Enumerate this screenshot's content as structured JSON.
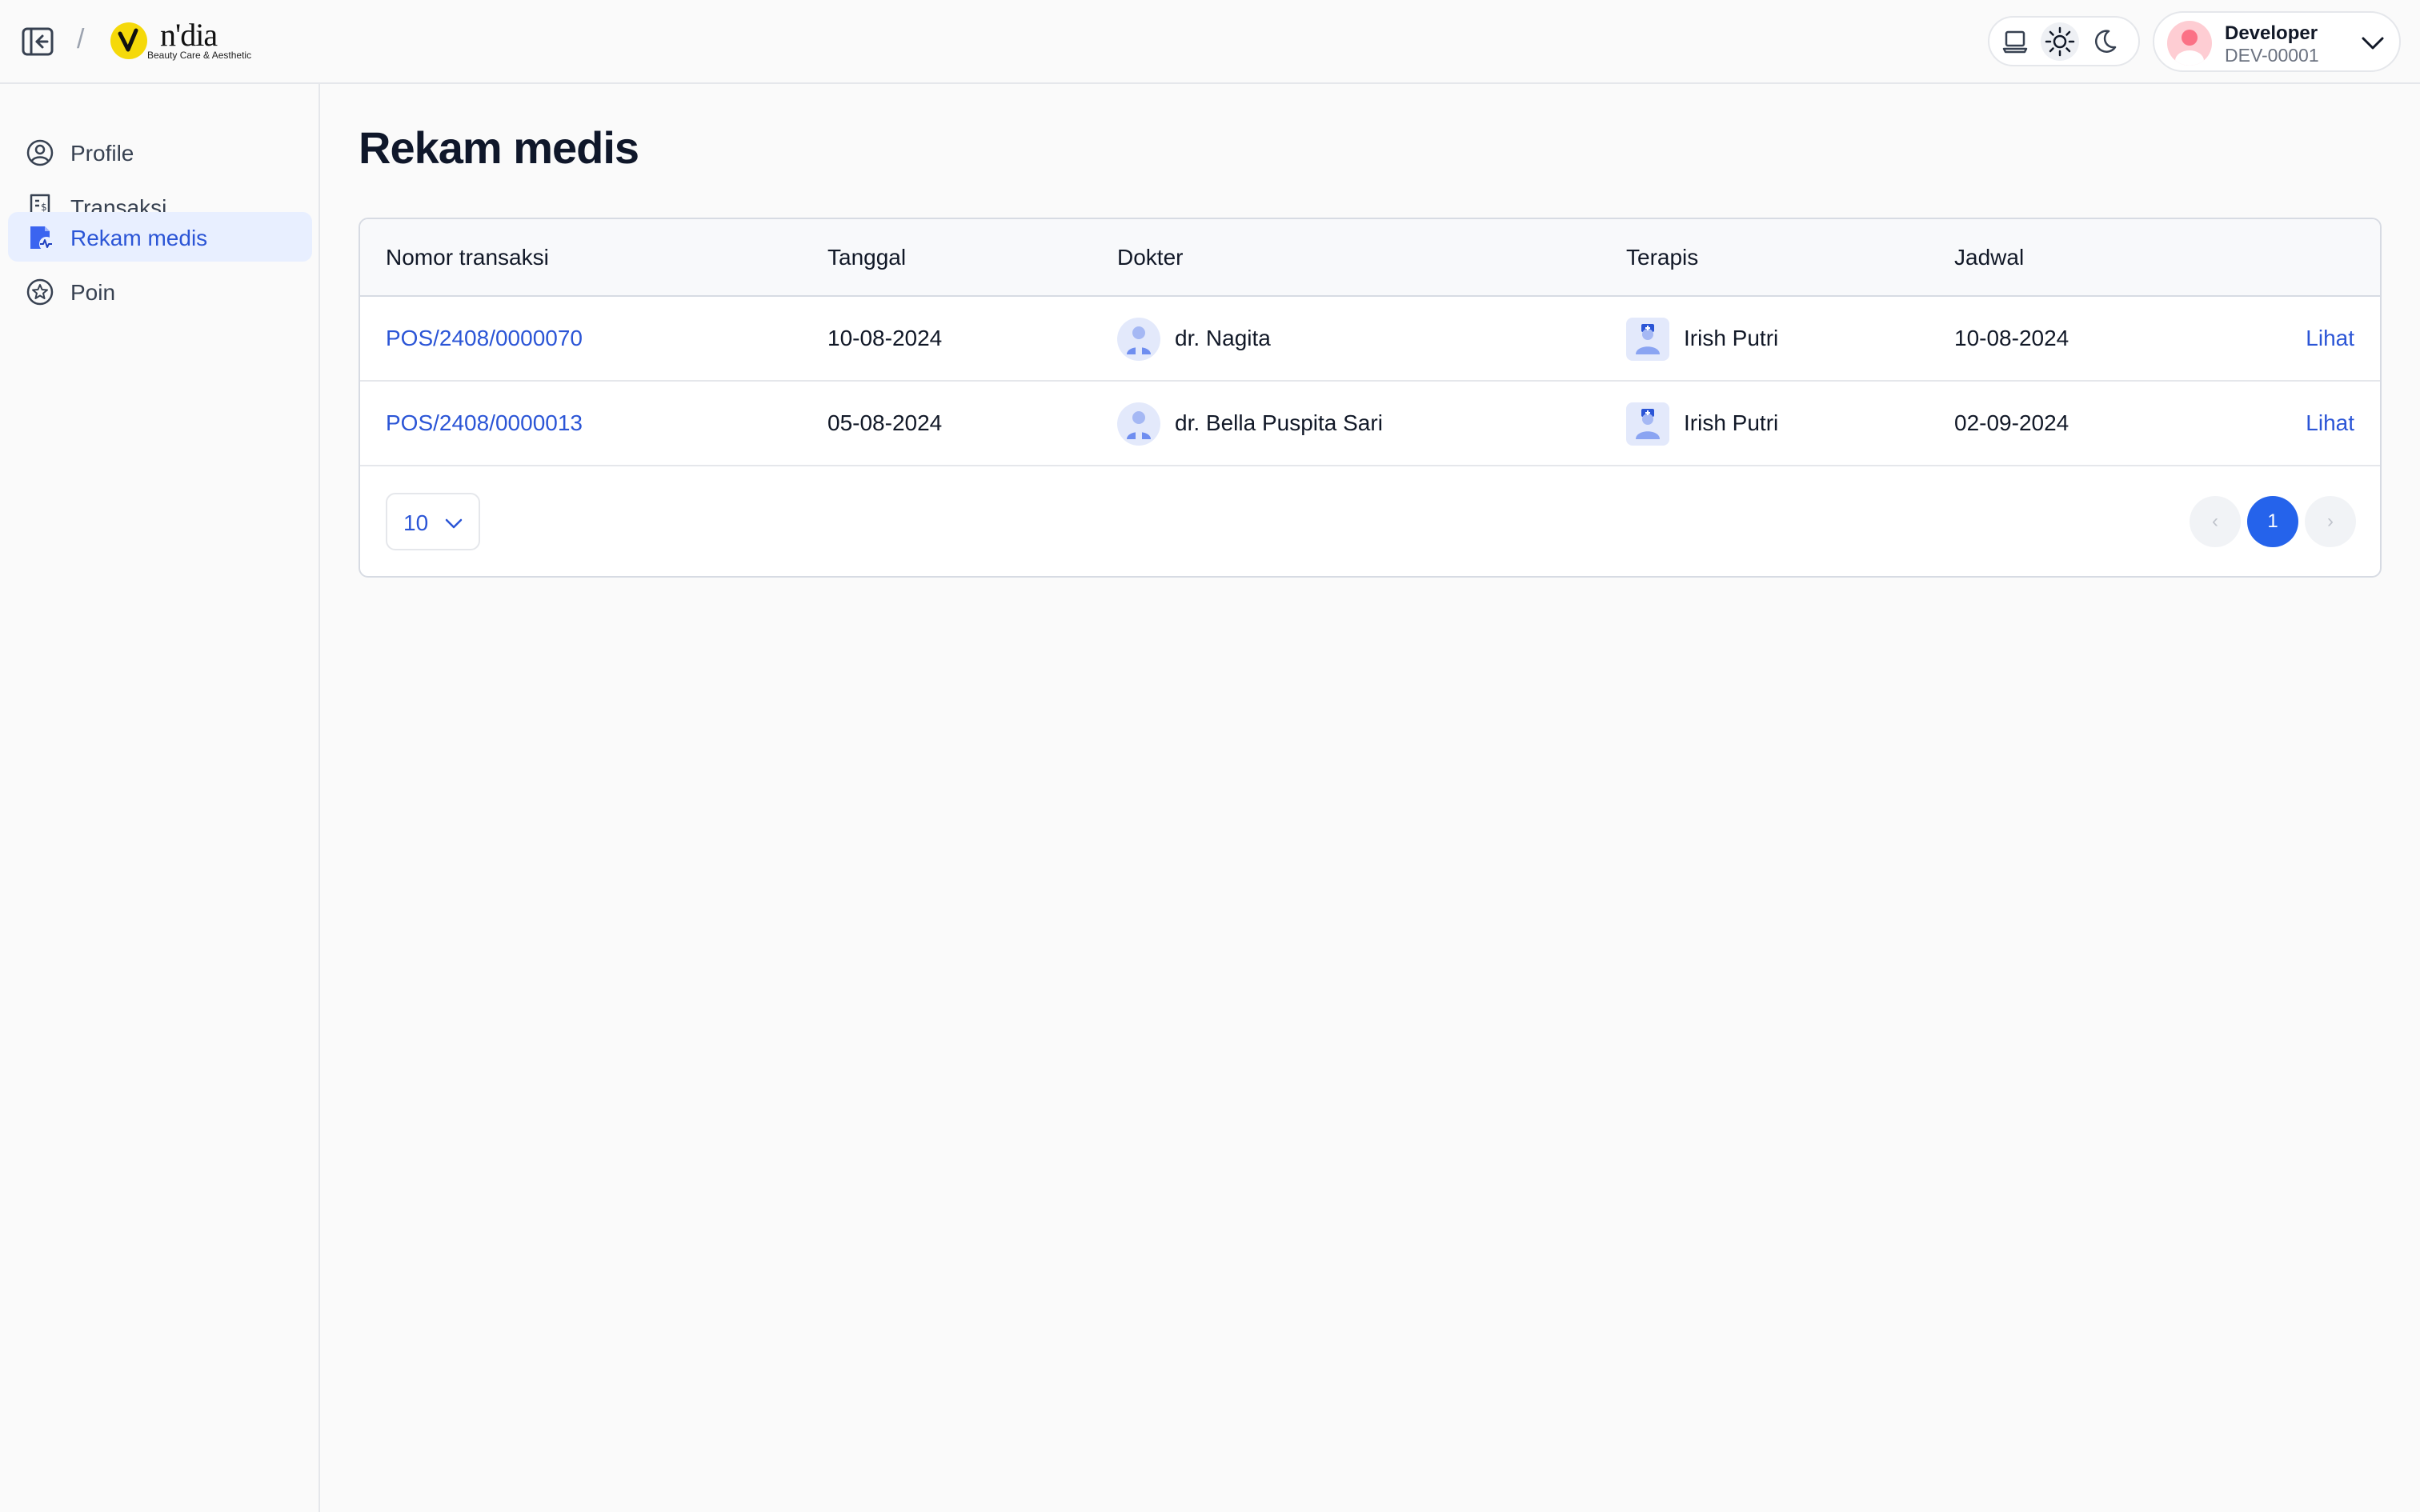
{
  "header": {
    "breadcrumb_separator": "/",
    "logo": {
      "name": "n'dia",
      "tagline": "Beauty Care & Aesthetic"
    },
    "theme": {
      "options": [
        "system",
        "light",
        "dark"
      ],
      "active": "light"
    },
    "user": {
      "name": "Developer",
      "id": "DEV-00001"
    }
  },
  "sidebar": {
    "items": [
      {
        "label": "Profile",
        "icon": "user-circle-icon",
        "active": false
      },
      {
        "label": "Transaksi",
        "icon": "receipt-icon",
        "active": false
      },
      {
        "label": "Rekam medis",
        "icon": "medical-record-icon",
        "active": true
      },
      {
        "label": "Poin",
        "icon": "star-badge-icon",
        "active": false
      }
    ]
  },
  "main": {
    "title": "Rekam medis",
    "table": {
      "columns": [
        "Nomor transaksi",
        "Tanggal",
        "Dokter",
        "Terapis",
        "Jadwal"
      ],
      "rows": [
        {
          "nomor": "POS/2408/0000070",
          "tanggal": "10-08-2024",
          "dokter": "dr. Nagita",
          "terapis": "Irish Putri",
          "jadwal": "10-08-2024",
          "action": "Lihat"
        },
        {
          "nomor": "POS/2408/0000013",
          "tanggal": "05-08-2024",
          "dokter": "dr. Bella Puspita Sari",
          "terapis": "Irish Putri",
          "jadwal": "02-09-2024",
          "action": "Lihat"
        }
      ]
    },
    "pagination": {
      "page_size": "10",
      "prev": "‹",
      "current_page": "1",
      "next": "›"
    }
  },
  "colors": {
    "accent": "#2b55d6",
    "active_bg": "#e8efff",
    "current_page": "#2563eb",
    "logo_yellow": "#f5d90a"
  }
}
